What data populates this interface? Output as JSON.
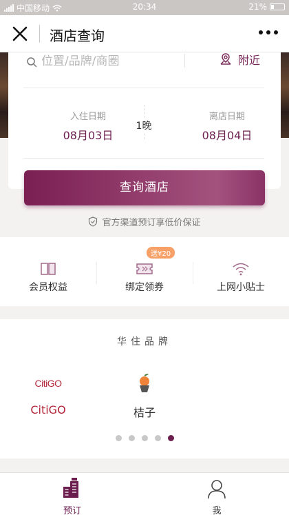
{
  "status_bar": {
    "carrier": "中国移动",
    "time": "20:34",
    "battery": "21%"
  },
  "nav": {
    "title": "酒店查询"
  },
  "search": {
    "placeholder": "位置/品牌/商圈",
    "nearby_label": "附近"
  },
  "dates": {
    "checkin_label": "入住日期",
    "checkin_value": "08月03日",
    "nights": "1晚",
    "checkout_label": "离店日期",
    "checkout_value": "08月04日"
  },
  "search_button": "查询酒店",
  "guarantee": "官方渠道预订享低价保证",
  "services": [
    {
      "label": "会员权益",
      "icon": "book-icon"
    },
    {
      "label": "绑定领券",
      "icon": "ticket-icon",
      "badge": "送¥20"
    },
    {
      "label": "上网小贴士",
      "icon": "wifi-icon"
    }
  ],
  "brands": {
    "title": "华住品牌",
    "items": [
      {
        "logo_text": "CitiGO",
        "name": "CitiGO"
      },
      {
        "name": "桔子"
      }
    ],
    "page_count": 5,
    "active_page": 5
  },
  "tabs": [
    {
      "label": "预订",
      "active": true
    },
    {
      "label": "我",
      "active": false
    }
  ],
  "colors": {
    "brand": "#6b1e4e",
    "promo": "#f7a068"
  }
}
